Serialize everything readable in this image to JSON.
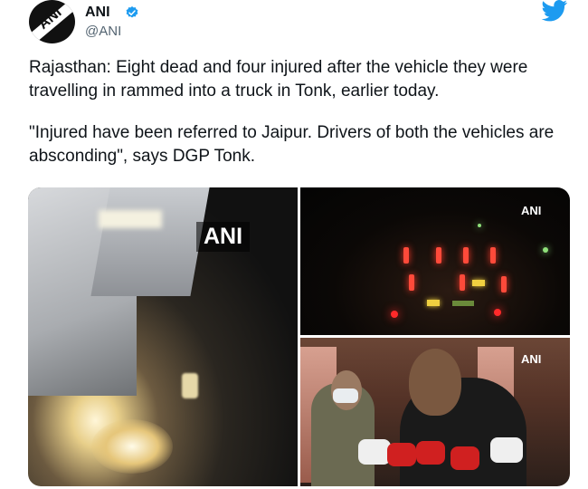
{
  "account": {
    "name": "ANI",
    "handle": "@ANI",
    "verified": true,
    "avatar_icon": "ani-logo-avatar",
    "avatar_text": "ANI"
  },
  "brand": {
    "icon": "twitter-bird-icon",
    "color": "#1d9bf0"
  },
  "tweet": {
    "paragraph1": "Rajasthan: Eight dead and four injured after the vehicle they were travelling in rammed into a truck in Tonk, earlier today.",
    "paragraph2": "\"Injured have been referred to Jaipur. Drivers of both the vehicles are absconding\", says DGP Tonk."
  },
  "media": {
    "photos": [
      {
        "watermark": "ANI"
      },
      {
        "watermark": "ANI"
      },
      {
        "watermark": "ANI"
      }
    ]
  }
}
